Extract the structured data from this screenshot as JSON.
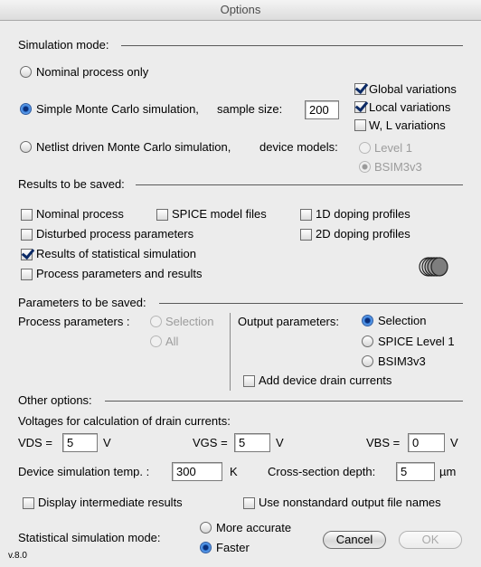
{
  "window": {
    "title": "Options",
    "version": "v.8.0"
  },
  "simulation_mode": {
    "heading": "Simulation mode:",
    "nominal_label": "Nominal process only",
    "simple_mc_label": "Simple Monte Carlo simulation,",
    "sample_size_label": "sample size:",
    "sample_size_value": "200",
    "netlist_label": "Netlist driven Monte Carlo simulation,",
    "device_models_label": "device models:",
    "global_variations": "Global variations",
    "local_variations": "Local variations",
    "wl_variations": "W, L variations",
    "level1": "Level 1",
    "bsim": "BSIM3v3"
  },
  "results_saved": {
    "heading": "Results to be saved:",
    "nominal_process": "Nominal process",
    "spice_model_files": "SPICE model files",
    "doping_1d": "1D doping profiles",
    "disturbed_params": "Disturbed process parameters",
    "doping_2d": "2D doping profiles",
    "statistical_results": "Results of statistical simulation",
    "process_params_results": "Process parameters and results"
  },
  "params_saved": {
    "heading": "Parameters to be saved:",
    "process_params_label": "Process parameters :",
    "selection": "Selection",
    "all": "All",
    "output_params_label": "Output parameters:",
    "out_selection": "Selection",
    "spice_level1": "SPICE Level 1",
    "bsim": "BSIM3v3",
    "add_drain_currents": "Add device drain currents"
  },
  "other_options": {
    "heading": "Other options:",
    "voltages_label": "Voltages for calculation of drain currents:",
    "vds_label": "VDS =",
    "vds_value": "5",
    "vgs_label": "VGS =",
    "vgs_value": "5",
    "vbs_label": "VBS =",
    "vbs_value": "0",
    "unit_v": "V",
    "temp_label": "Device simulation temp. :",
    "temp_value": "300",
    "temp_unit": "K",
    "cross_label": "Cross-section depth:",
    "cross_value": "5",
    "cross_unit": "µm",
    "display_intermediate": "Display intermediate results",
    "nonstandard_names": "Use nonstandard output file names",
    "stat_mode_label": "Statistical simulation mode:",
    "more_accurate": "More accurate",
    "faster": "Faster"
  },
  "buttons": {
    "cancel": "Cancel",
    "ok": "OK"
  }
}
